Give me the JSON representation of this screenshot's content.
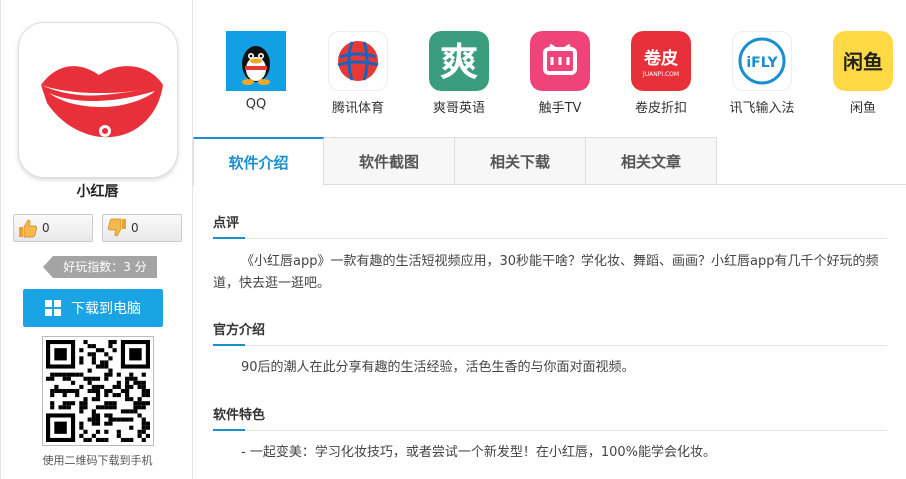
{
  "app": {
    "name": "小红唇",
    "likes": "0",
    "dislikes": "0",
    "score_text": "好玩指数：3 分",
    "download_label": "下载到电脑",
    "qr_caption": "使用二维码下载到手机"
  },
  "related_apps": [
    {
      "label": "QQ",
      "icon": "qq-penguin-icon"
    },
    {
      "label": "腾讯体育",
      "icon": "tencent-sports-icon"
    },
    {
      "label": "爽哥英语",
      "icon": "shuangge-english-icon"
    },
    {
      "label": "触手TV",
      "icon": "chushou-tv-icon"
    },
    {
      "label": "卷皮折扣",
      "icon": "juanpi-icon",
      "icon_text": "卷皮",
      "icon_subtext": "JUANPI.COM"
    },
    {
      "label": "讯飞输入法",
      "icon": "ifly-icon",
      "icon_text": "iFLY"
    },
    {
      "label": "闲鱼",
      "icon": "xianyu-icon",
      "icon_text": "闲鱼"
    }
  ],
  "tabs": [
    {
      "label": "软件介绍",
      "active": true
    },
    {
      "label": "软件截图",
      "active": false
    },
    {
      "label": "相关下载",
      "active": false
    },
    {
      "label": "相关文章",
      "active": false
    }
  ],
  "sections": [
    {
      "title": "点评",
      "text": "《小红唇app》一款有趣的生活短视频应用，30秒能干啥？学化妆、舞蹈、画画？小红唇app有几千个好玩的频道，快去逛一逛吧。"
    },
    {
      "title": "官方介绍",
      "text": "90后的潮人在此分享有趣的生活经验，活色生香的与你面对面视频。"
    },
    {
      "title": "软件特色",
      "text": "- 一起变美：学习化妆技巧，或者尝试一个新发型！在小红唇，100%能学会化妆。"
    }
  ],
  "colors": {
    "accent": "#1a8fd0",
    "download_button": "#1aa4e3",
    "lips_red": "#e8303a"
  }
}
